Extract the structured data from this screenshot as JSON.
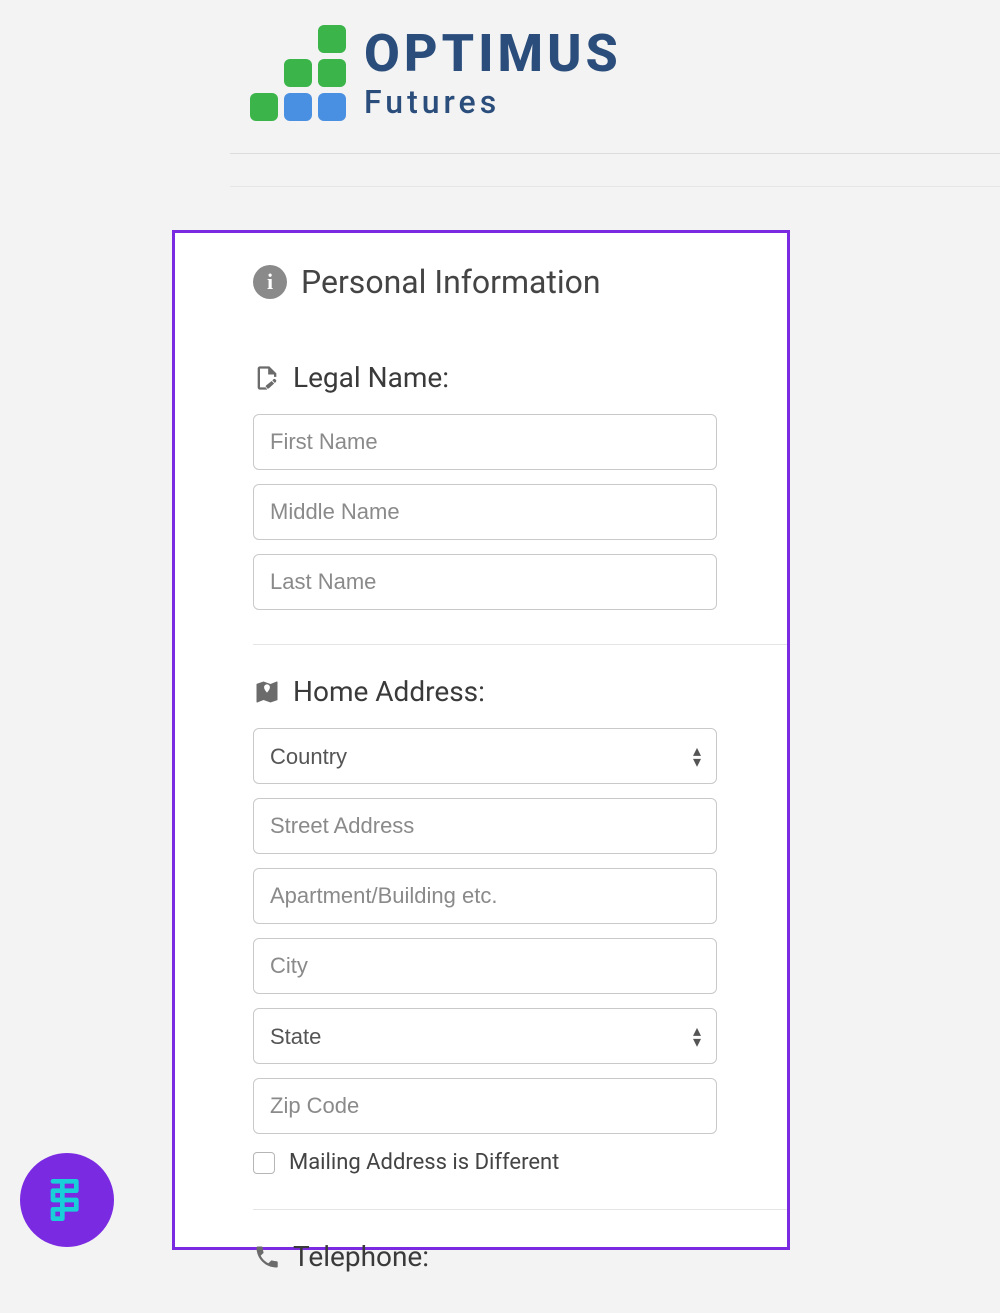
{
  "brand": {
    "title": "OPTIMUS",
    "subtitle": "Futures"
  },
  "form": {
    "section_title": "Personal Information",
    "legal_name": {
      "label": "Legal Name:",
      "first_placeholder": "First Name",
      "middle_placeholder": "Middle Name",
      "last_placeholder": "Last Name"
    },
    "home_address": {
      "label": "Home Address:",
      "country_placeholder": "Country",
      "street_placeholder": "Street Address",
      "apt_placeholder": "Apartment/Building etc.",
      "city_placeholder": "City",
      "state_placeholder": "State",
      "zip_placeholder": "Zip Code",
      "mailing_diff_label": "Mailing Address is Different"
    },
    "telephone": {
      "label": "Telephone:"
    }
  }
}
